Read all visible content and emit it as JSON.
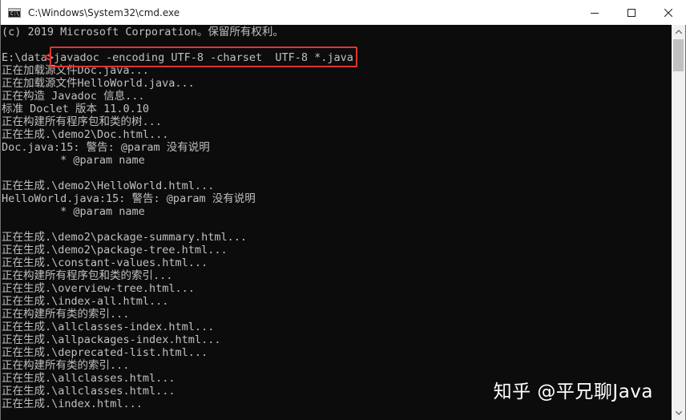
{
  "window": {
    "title": "C:\\Windows\\System32\\cmd.exe",
    "icon_text": "C:\\",
    "icons": {
      "app": "cmd-icon",
      "minimize": "minimize-icon",
      "maximize": "maximize-icon",
      "close": "close-icon"
    }
  },
  "console": {
    "lines": [
      "(c) 2019 Microsoft Corporation。保留所有权利。",
      "",
      "E:\\data>javadoc -encoding UTF-8 -charset  UTF-8 *.java",
      "正在加载源文件Doc.java...",
      "正在加载源文件HelloWorld.java...",
      "正在构造 Javadoc 信息...",
      "标准 Doclet 版本 11.0.10",
      "正在构建所有程序包和类的树...",
      "正在生成.\\demo2\\Doc.html...",
      "Doc.java:15: 警告: @param 没有说明",
      "         * @param name",
      "",
      "正在生成.\\demo2\\HelloWorld.html...",
      "HelloWorld.java:15: 警告: @param 没有说明",
      "         * @param name",
      "",
      "正在生成.\\demo2\\package-summary.html...",
      "正在生成.\\demo2\\package-tree.html...",
      "正在生成.\\constant-values.html...",
      "正在构建所有程序包和类的索引...",
      "正在生成.\\overview-tree.html...",
      "正在生成.\\index-all.html...",
      "正在构建所有类的索引...",
      "正在生成.\\allclasses-index.html...",
      "正在生成.\\allpackages-index.html...",
      "正在生成.\\deprecated-list.html...",
      "正在构建所有类的索引...",
      "正在生成.\\allclasses.html...",
      "正在生成.\\allclasses.html...",
      "正在生成.\\index.html..."
    ]
  },
  "annotation": {
    "highlight_color": "#e03535"
  },
  "watermark": {
    "text": "知乎 @平兄聊Java"
  },
  "colors": {
    "console_bg": "#0c0c0c",
    "console_text": "#c0c0c0",
    "titlebar_bg": "#ffffff"
  }
}
